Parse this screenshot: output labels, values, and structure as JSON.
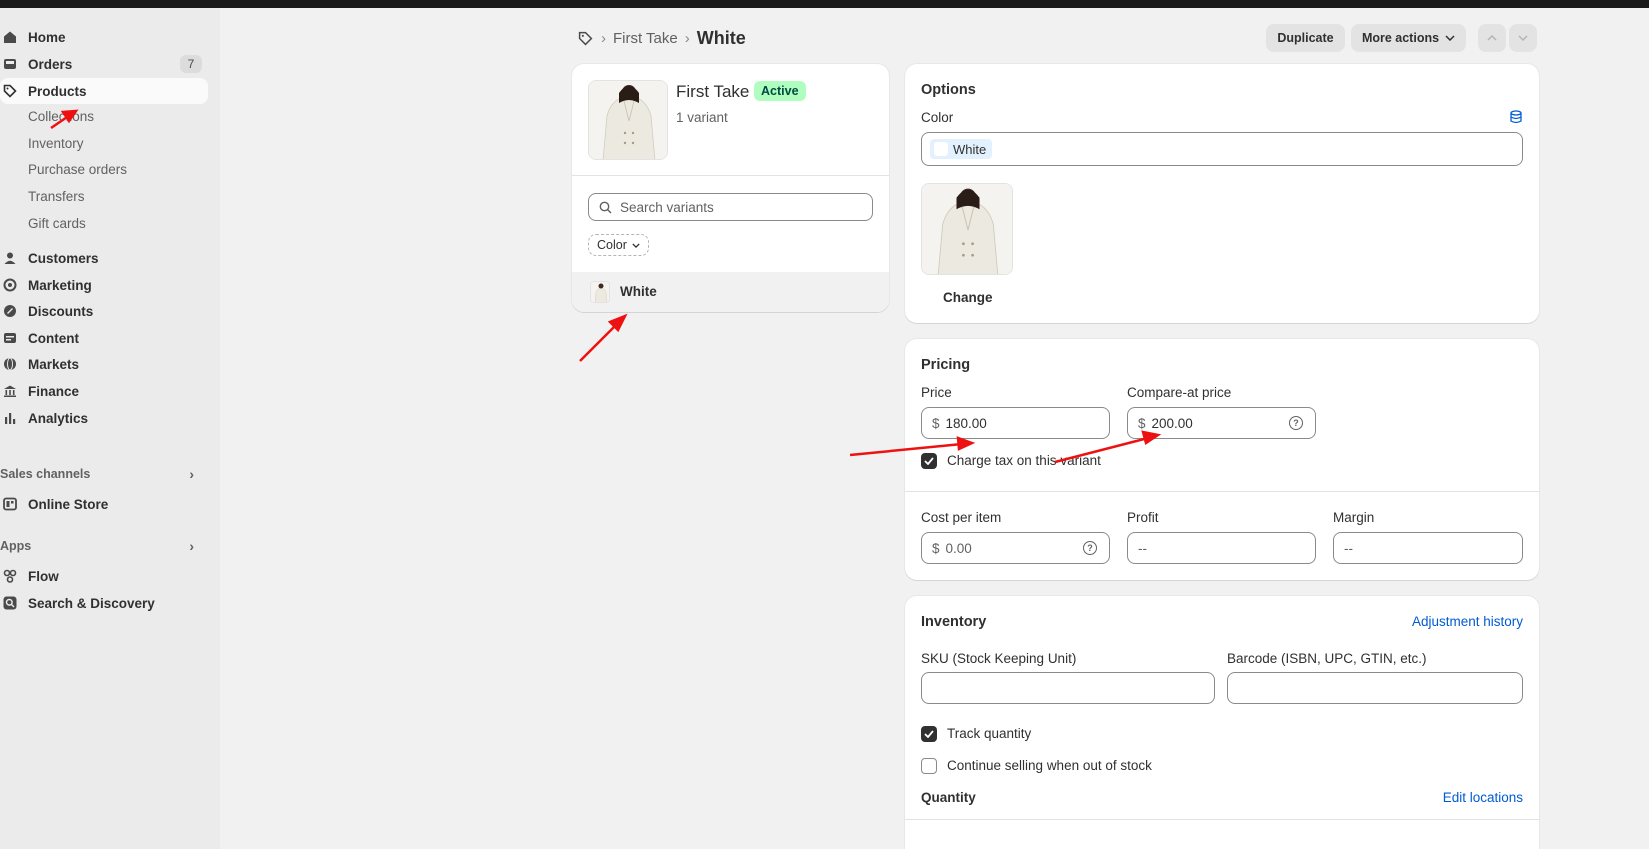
{
  "sidebar": {
    "items": [
      {
        "label": "Home",
        "icon": "home-icon"
      },
      {
        "label": "Orders",
        "icon": "orders-icon",
        "badge": "7"
      },
      {
        "label": "Products",
        "icon": "tag-icon"
      },
      {
        "label": "Customers",
        "icon": "person-icon"
      },
      {
        "label": "Marketing",
        "icon": "target-icon"
      },
      {
        "label": "Discounts",
        "icon": "discount-icon"
      },
      {
        "label": "Content",
        "icon": "content-icon"
      },
      {
        "label": "Markets",
        "icon": "globe-icon"
      },
      {
        "label": "Finance",
        "icon": "bank-icon"
      },
      {
        "label": "Analytics",
        "icon": "chart-icon"
      }
    ],
    "product_sub": [
      "Collections",
      "Inventory",
      "Purchase orders",
      "Transfers",
      "Gift cards"
    ],
    "sales_channels": {
      "label": "Sales channels",
      "items": [
        {
          "label": "Online Store",
          "icon": "store-icon"
        }
      ]
    },
    "apps": {
      "label": "Apps",
      "items": [
        {
          "label": "Flow",
          "icon": "flow-icon"
        },
        {
          "label": "Search & Discovery",
          "icon": "search-discovery-icon"
        }
      ]
    }
  },
  "header": {
    "breadcrumb_parent": "First Take",
    "breadcrumb_sep": "›",
    "page_title": "White",
    "duplicate_label": "Duplicate",
    "more_actions_label": "More actions"
  },
  "product_card": {
    "name": "First Take",
    "status": "Active",
    "variant_count": "1 variant",
    "search_placeholder": "Search variants",
    "filter_label": "Color",
    "variants": [
      {
        "label": "White"
      }
    ]
  },
  "options": {
    "title": "Options",
    "color_label": "Color",
    "color_value": "White",
    "change_label": "Change"
  },
  "pricing": {
    "title": "Pricing",
    "price_label": "Price",
    "price_value": "180.00",
    "compare_label": "Compare-at price",
    "compare_value": "200.00",
    "currency": "$",
    "charge_tax_label": "Charge tax on this variant",
    "cost_label": "Cost per item",
    "cost_value": "0.00",
    "profit_label": "Profit",
    "profit_value": "--",
    "margin_label": "Margin",
    "margin_value": "--"
  },
  "inventory": {
    "title": "Inventory",
    "history_link": "Adjustment history",
    "sku_label": "SKU (Stock Keeping Unit)",
    "barcode_label": "Barcode (ISBN, UPC, GTIN, etc.)",
    "track_label": "Track quantity",
    "continue_label": "Continue selling when out of stock",
    "quantity_title": "Quantity",
    "edit_locations": "Edit locations"
  },
  "colors": {
    "accent": "#005bd3",
    "active_badge_bg": "#affebf",
    "active_badge_text": "#014b40",
    "annotation_arrow": "#ee1111"
  }
}
